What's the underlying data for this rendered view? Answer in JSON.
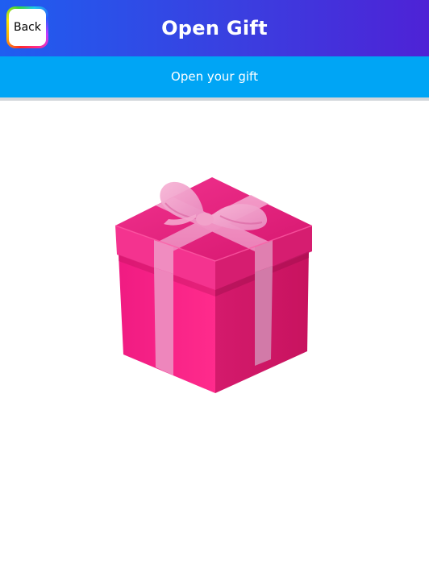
{
  "app": {
    "title": "Open Gift",
    "back_label": "Back",
    "subtitle": "Open your gift"
  },
  "colors": {
    "header_gradient": [
      "#1f5ef0",
      "#4e22d6"
    ],
    "subheader": "#00a5f5",
    "gift_box": "#e8177a",
    "ribbon": "#f08cc0"
  },
  "icons": {
    "gift": "gift-box-icon"
  }
}
